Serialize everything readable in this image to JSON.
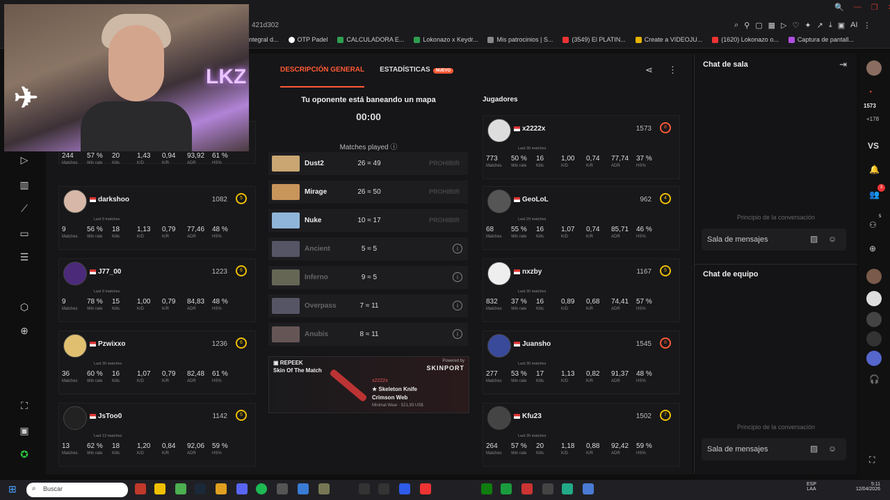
{
  "browser": {
    "tab_fragment": "421d302",
    "bookmarks": [
      "ntegral d...",
      "OTP Padel",
      "CALCULADORA E...",
      "Lokonazo x Keydr...",
      "Mis patrocinios | S...",
      "(3549) El PLATIN...",
      "Create a VIDEOJU...",
      "(1620) Lokonazo o...",
      "Captura de pantall..."
    ],
    "ai_label": "AI"
  },
  "match": {
    "tabs": {
      "general": "DESCRIPCIÓN GENERAL",
      "stats": "ESTADÍSTICAS",
      "new_badge": "NUEVO"
    },
    "ban_status": "Tu oponente está baneando un mapa",
    "timer": "00:00",
    "matches_played": "Matches played",
    "players_title": "Jugadores",
    "ban_action": "PROHIBIR",
    "maps": [
      {
        "name": "Dust2",
        "score": "26 ≈ 49",
        "banned": false,
        "color": "#c9a672"
      },
      {
        "name": "Mirage",
        "score": "26 ≈ 50",
        "banned": false,
        "color": "#c8955b"
      },
      {
        "name": "Nuke",
        "score": "10 ≈ 17",
        "banned": false,
        "color": "#8fb6d8"
      },
      {
        "name": "Ancient",
        "score": "5 ≈ 5",
        "banned": true,
        "color": "#556"
      },
      {
        "name": "Inferno",
        "score": "9 ≈ 5",
        "banned": true,
        "color": "#665"
      },
      {
        "name": "Overpass",
        "score": "7 ≈ 11",
        "banned": true,
        "color": "#556"
      },
      {
        "name": "Anubis",
        "score": "8 ≈ 11",
        "banned": true,
        "color": "#655"
      }
    ],
    "skin": {
      "sponsor": "REPEEK",
      "title": "Skin Of The Match",
      "powered": "Powered by",
      "brand": "SKINPORT",
      "owner": "x2222x",
      "item": "★ Skeleton Knife",
      "variant": "Crimson Web",
      "price": "Minimal Wear · 521,93 US$"
    },
    "stat_labels": [
      "Matches",
      "Win rate",
      "Kills",
      "K/D",
      "K/R",
      "ADR",
      "HS%"
    ],
    "left_players": [
      {
        "name": "",
        "elo": "",
        "level": "",
        "last": "",
        "stats": [
          "244",
          "57 %",
          "20",
          "1,43",
          "0,94",
          "93,92",
          "61 %"
        ]
      },
      {
        "name": "darkshoo",
        "elo": "1082",
        "level": "5",
        "last": "Last 9 matches",
        "stats": [
          "9",
          "56 %",
          "18",
          "1,13",
          "0,79",
          "77,46",
          "48 %"
        ]
      },
      {
        "name": "J77_00",
        "elo": "1223",
        "level": "6",
        "last": "Last 9 matches",
        "stats": [
          "9",
          "78 %",
          "15",
          "1,00",
          "0,79",
          "84,83",
          "48 %"
        ]
      },
      {
        "name": "Pzwixxo",
        "elo": "1236",
        "level": "6",
        "last": "Last 30 matches",
        "stats": [
          "36",
          "60 %",
          "16",
          "1,07",
          "0,79",
          "82,48",
          "61 %"
        ]
      },
      {
        "name": "JsToo0",
        "elo": "1142",
        "level": "5",
        "last": "Last 13 matches",
        "stats": [
          "13",
          "62 %",
          "18",
          "1,20",
          "0,84",
          "92,06",
          "59 %"
        ]
      }
    ],
    "right_players": [
      {
        "name": "x2222x",
        "elo": "1573",
        "level": "8",
        "last": "Last 30 matches",
        "stats": [
          "773",
          "50 %",
          "16",
          "1,00",
          "0,74",
          "77,74",
          "37 %"
        ]
      },
      {
        "name": "GeoLoL",
        "elo": "962",
        "level": "4",
        "last": "Last 29 matches",
        "stats": [
          "68",
          "55 %",
          "16",
          "1,07",
          "0,74",
          "85,71",
          "46 %"
        ]
      },
      {
        "name": "nxzby",
        "elo": "1167",
        "level": "5",
        "last": "Last 30 matches",
        "stats": [
          "832",
          "37 %",
          "16",
          "0,89",
          "0,68",
          "74,41",
          "57 %"
        ]
      },
      {
        "name": "Juansho",
        "elo": "1545",
        "level": "8",
        "last": "Last 30 matches",
        "stats": [
          "277",
          "53 %",
          "17",
          "1,13",
          "0,82",
          "91,37",
          "48 %"
        ]
      },
      {
        "name": "Kfu23",
        "elo": "1502",
        "level": "7",
        "last": "Last 30 matches",
        "stats": [
          "264",
          "57 %",
          "20",
          "1,18",
          "0,88",
          "92,42",
          "59 %"
        ]
      }
    ]
  },
  "chat": {
    "room_title": "Chat de sala",
    "team_title": "Chat de equipo",
    "empty": "Principio de la conversación",
    "placeholder": "Sala de mensajes"
  },
  "rightbar": {
    "elo": "1573",
    "delta": "+178",
    "vs": "VS",
    "notif": "3",
    "friends": "5"
  },
  "taskbar": {
    "search": "Buscar",
    "lang": "ESP",
    "lang2": "LAA",
    "time": "5:11",
    "date": "12/04/2026"
  }
}
